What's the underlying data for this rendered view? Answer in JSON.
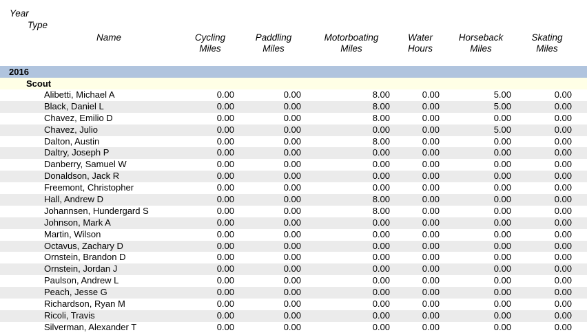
{
  "headers": {
    "year": "Year",
    "type": "Type",
    "name": "Name",
    "cycling": [
      "Cycling",
      "Miles"
    ],
    "paddling": [
      "Paddling",
      "Miles"
    ],
    "motorboating": [
      "Motorboating",
      "Miles"
    ],
    "water": [
      "Water",
      "Hours"
    ],
    "horseback": [
      "Horseback",
      "Miles"
    ],
    "skating": [
      "Skating",
      "Miles"
    ]
  },
  "group": {
    "year": "2016",
    "type": "Scout"
  },
  "rows": [
    [
      "Alibetti, Michael A",
      "0.00",
      "0.00",
      "8.00",
      "0.00",
      "5.00",
      "0.00"
    ],
    [
      "Black, Daniel L",
      "0.00",
      "0.00",
      "8.00",
      "0.00",
      "5.00",
      "0.00"
    ],
    [
      "Chavez, Emilio D",
      "0.00",
      "0.00",
      "8.00",
      "0.00",
      "0.00",
      "0.00"
    ],
    [
      "Chavez, Julio",
      "0.00",
      "0.00",
      "0.00",
      "0.00",
      "5.00",
      "0.00"
    ],
    [
      "Dalton, Austin",
      "0.00",
      "0.00",
      "8.00",
      "0.00",
      "0.00",
      "0.00"
    ],
    [
      "Daltry, Joseph P",
      "0.00",
      "0.00",
      "0.00",
      "0.00",
      "0.00",
      "0.00"
    ],
    [
      "Danberry, Samuel W",
      "0.00",
      "0.00",
      "0.00",
      "0.00",
      "0.00",
      "0.00"
    ],
    [
      "Donaldson, Jack R",
      "0.00",
      "0.00",
      "0.00",
      "0.00",
      "0.00",
      "0.00"
    ],
    [
      "Freemont, Christopher",
      "0.00",
      "0.00",
      "0.00",
      "0.00",
      "0.00",
      "0.00"
    ],
    [
      "Hall, Andrew D",
      "0.00",
      "0.00",
      "8.00",
      "0.00",
      "0.00",
      "0.00"
    ],
    [
      "Johannsen, Hundergard S",
      "0.00",
      "0.00",
      "8.00",
      "0.00",
      "0.00",
      "0.00"
    ],
    [
      "Johnson, Mark A",
      "0.00",
      "0.00",
      "0.00",
      "0.00",
      "0.00",
      "0.00"
    ],
    [
      "Martin, Wilson",
      "0.00",
      "0.00",
      "0.00",
      "0.00",
      "0.00",
      "0.00"
    ],
    [
      "Octavus, Zachary D",
      "0.00",
      "0.00",
      "0.00",
      "0.00",
      "0.00",
      "0.00"
    ],
    [
      "Ornstein, Brandon D",
      "0.00",
      "0.00",
      "0.00",
      "0.00",
      "0.00",
      "0.00"
    ],
    [
      "Ornstein, Jordan J",
      "0.00",
      "0.00",
      "0.00",
      "0.00",
      "0.00",
      "0.00"
    ],
    [
      "Paulson, Andrew L",
      "0.00",
      "0.00",
      "0.00",
      "0.00",
      "0.00",
      "0.00"
    ],
    [
      "Peach, Jesse G",
      "0.00",
      "0.00",
      "0.00",
      "0.00",
      "0.00",
      "0.00"
    ],
    [
      "Richardson, Ryan M",
      "0.00",
      "0.00",
      "0.00",
      "0.00",
      "0.00",
      "0.00"
    ],
    [
      "Ricoli, Travis",
      "0.00",
      "0.00",
      "0.00",
      "0.00",
      "0.00",
      "0.00"
    ],
    [
      "Silverman, Alexander T",
      "0.00",
      "0.00",
      "0.00",
      "0.00",
      "0.00",
      "0.00"
    ]
  ],
  "colors": {
    "year_band": "#b0c4de",
    "type_band": "#ffffe6",
    "alt_row": "#ebebeb"
  }
}
